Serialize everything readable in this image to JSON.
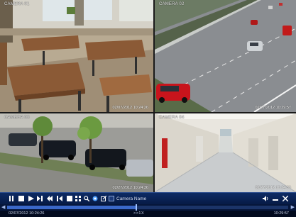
{
  "cameras": [
    {
      "name": "CAMERA 01",
      "timestamp": "02/07/2012 10:24:26"
    },
    {
      "name": "CAMERA 02",
      "timestamp": "02/27/2012 10:29:57"
    },
    {
      "name": "CAMERA 03",
      "timestamp": "02/27/2012 10:24:36"
    },
    {
      "name": "CAMERA 04",
      "timestamp": "02/27/2012 10:24:58"
    }
  ],
  "toolbar": {
    "camera_select_label": "Camera Name",
    "icons": [
      "stop-icon",
      "play-icon",
      "step-forward-icon",
      "rewind-icon",
      "step-backward-icon",
      "single-view-icon",
      "quad-view-icon",
      "zoom-icon",
      "snapshot-icon",
      "export-icon",
      "volume-icon",
      "minimize-icon",
      "close-icon"
    ]
  },
  "timeline": {
    "progress": 0.46,
    "center_label": ">>1X"
  },
  "status": {
    "start_time": "02/07/2012 10:24:26",
    "speed": ">>1X",
    "end_time": "10:29:57"
  },
  "colors": {
    "toolbar_bg": "#0d2b64",
    "timeline_fill": "#3a68c9"
  }
}
